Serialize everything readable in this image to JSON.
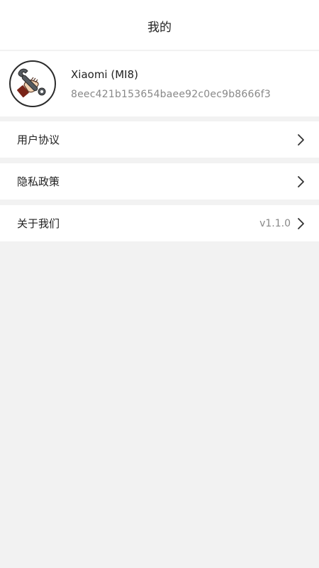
{
  "header": {
    "title": "我的"
  },
  "profile": {
    "avatar_icon": "wrench-in-hand-icon",
    "device_name": "Xiaomi (MI8)",
    "device_id": "8eec421b153654baee92c0ec9b8666f3"
  },
  "menu": {
    "items": [
      {
        "label": "用户协议",
        "value": "",
        "icon": "chevron-right-icon"
      },
      {
        "label": "隐私政策",
        "value": "",
        "icon": "chevron-right-icon"
      },
      {
        "label": "关于我们",
        "value": "v1.1.0",
        "icon": "chevron-right-icon"
      }
    ]
  },
  "colors": {
    "background": "#f2f2f2",
    "surface": "#ffffff",
    "text_primary": "#222222",
    "text_secondary": "#888888"
  }
}
